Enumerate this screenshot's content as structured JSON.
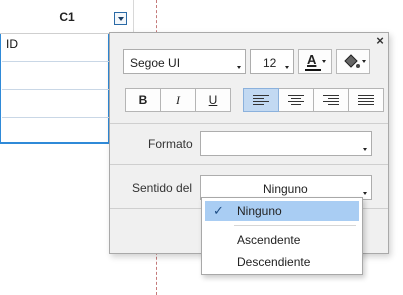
{
  "grid": {
    "column_header": "C1",
    "cells": [
      "ID",
      "",
      "",
      ""
    ]
  },
  "panel": {
    "font": {
      "family": "Segoe UI",
      "size": "12",
      "color_letter": "A"
    },
    "format_buttons": [
      {
        "name": "bold",
        "label": "B"
      },
      {
        "name": "italic",
        "label": "I"
      },
      {
        "name": "underline",
        "label": "U"
      }
    ],
    "align_buttons": [
      "align-left",
      "align-center",
      "align-right",
      "align-justify"
    ],
    "active_align": "align-left",
    "formato_label": "Formato",
    "formato_value": "",
    "sentido_label": "Sentido del",
    "sentido_value": "Ninguno",
    "close_label": "×"
  },
  "listbox": {
    "options": [
      "Ninguno",
      "Ascendente",
      "Descendiente"
    ],
    "selected": "Ninguno"
  },
  "colors": {
    "selection_blue": "#2f8ad8",
    "active_button": "#c2d9f2",
    "highlight": "#a9cdf3"
  }
}
